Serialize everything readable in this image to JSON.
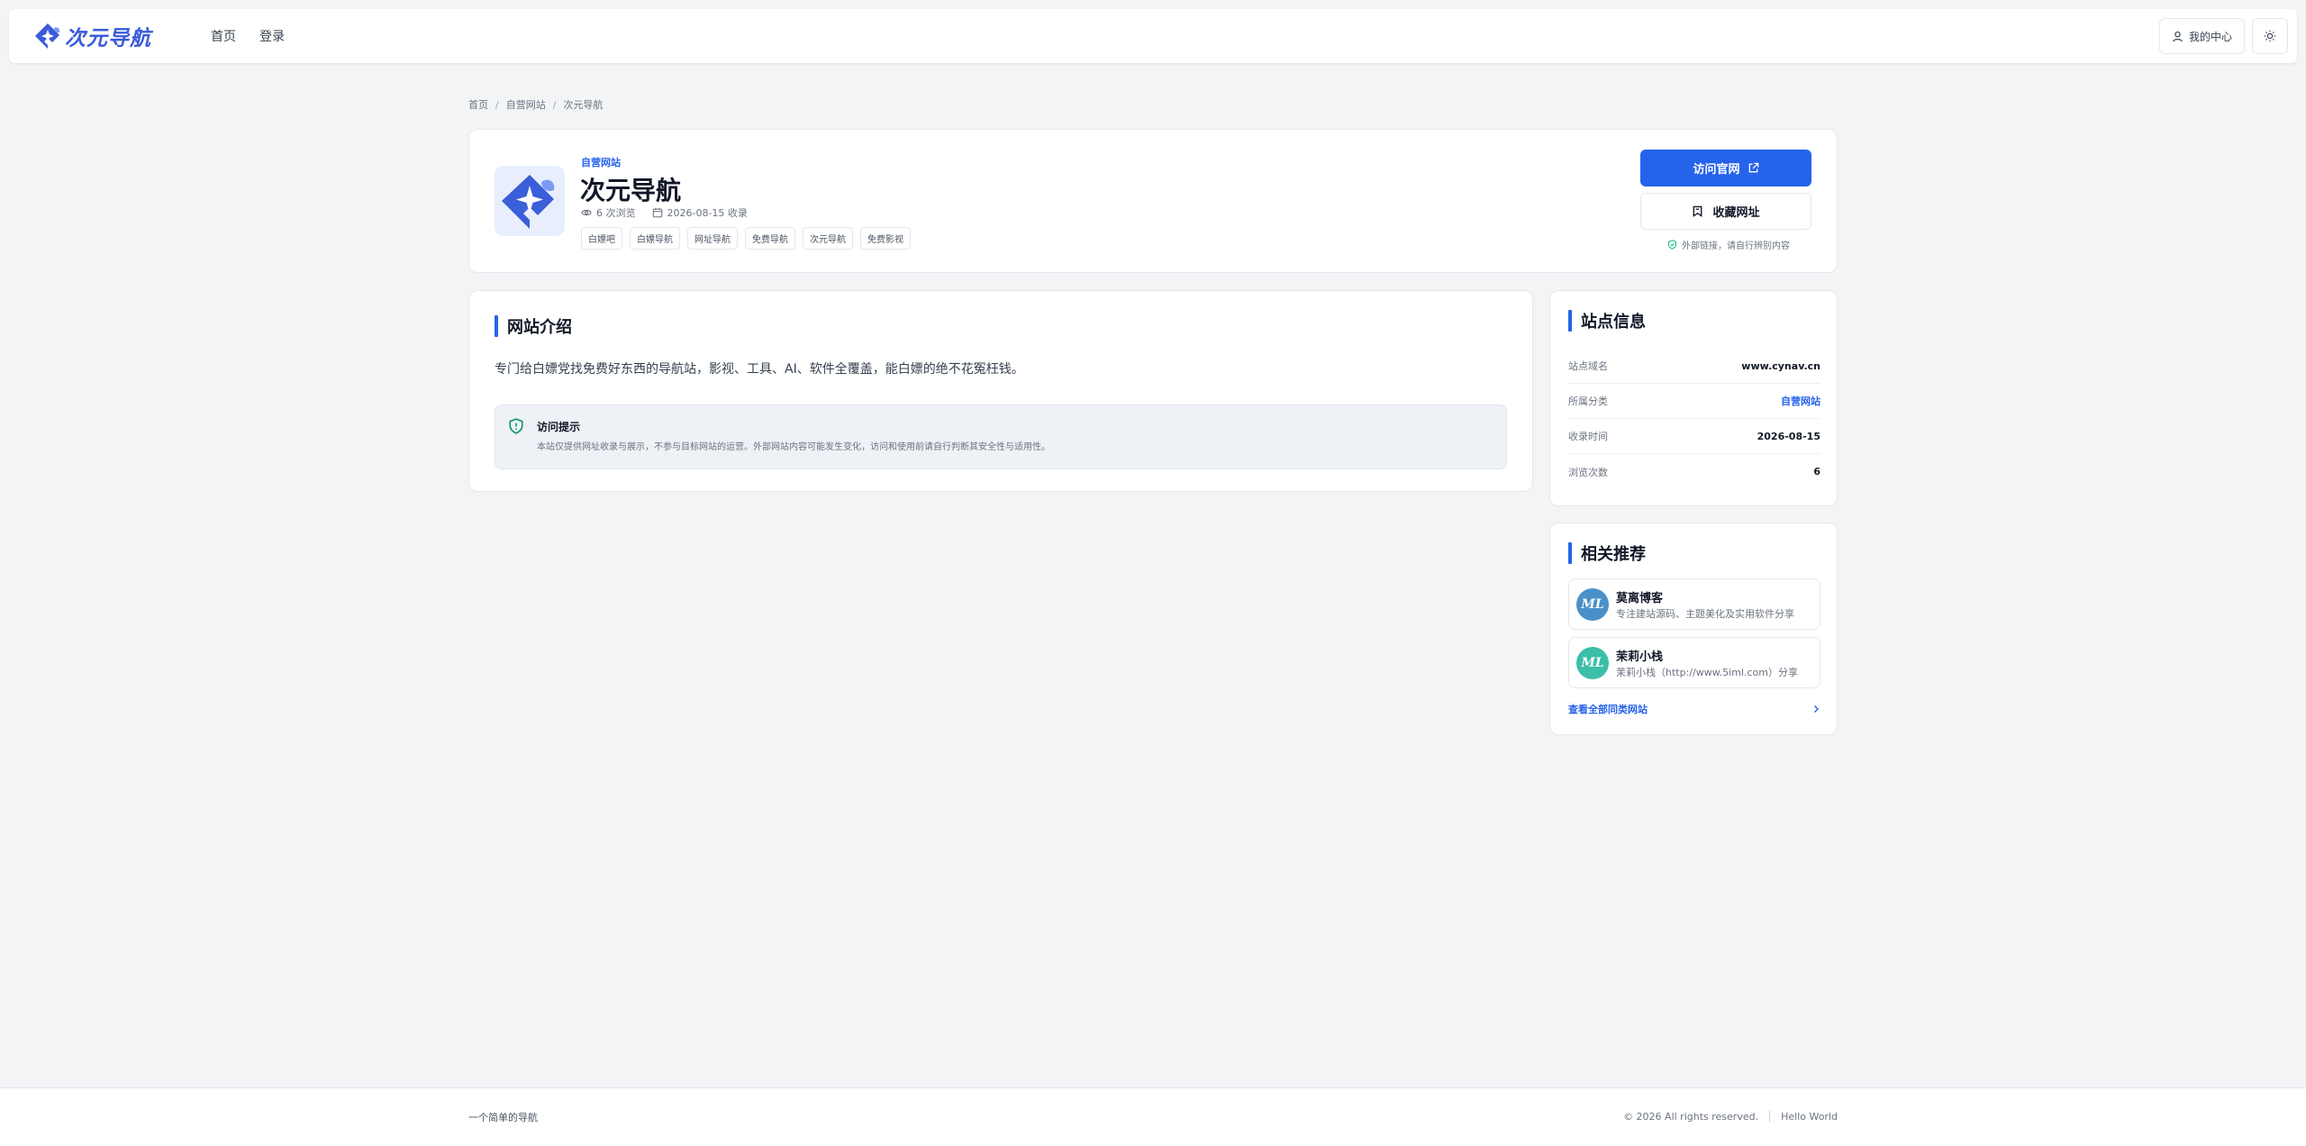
{
  "header": {
    "logo_text": "次元导航",
    "nav": [
      "首页",
      "登录"
    ],
    "user_center": "我的中心"
  },
  "breadcrumb": [
    "首页",
    "自营网站",
    "次元导航"
  ],
  "site": {
    "category": "自营网站",
    "title": "次元导航",
    "views": "6 次浏览",
    "collected": "2026-08-15 收录",
    "tags": [
      "白嫖吧",
      "白嫖导航",
      "网址导航",
      "免费导航",
      "次元导航",
      "免费影视"
    ],
    "visit_label": "访问官网",
    "fav_label": "收藏网址",
    "external_note": "外部链接，请自行辨别内容"
  },
  "intro": {
    "title": "网站介绍",
    "text": "专门给白嫖党找免费好东西的导航站，影视、工具、AI、软件全覆盖，能白嫖的绝不花冤枉钱。",
    "notice_title": "访问提示",
    "notice_text": "本站仅提供网址收录与展示，不参与目标网站的运营。外部网站内容可能发生变化，访问和使用前请自行判断其安全性与适用性。"
  },
  "info": {
    "title": "站点信息",
    "rows": [
      {
        "k": "站点域名",
        "v": "www.cynav.cn"
      },
      {
        "k": "所属分类",
        "v": "自营网站"
      },
      {
        "k": "收录时间",
        "v": "2026-08-15"
      },
      {
        "k": "浏览次数",
        "v": "6"
      }
    ]
  },
  "related": {
    "title": "相关推荐",
    "items": [
      {
        "avatar": "ML",
        "name": "莫离博客",
        "desc": "专注建站源码、主题美化及实用软件分享",
        "color": "#4a90c8"
      },
      {
        "avatar": "ML",
        "name": "茉莉小栈",
        "desc": "茉莉小栈（http://www.5iml.com）分享",
        "color": "#3bbfa8"
      }
    ],
    "more": "查看全部同类网站"
  },
  "footer": {
    "left": "一个简单的导航",
    "copyright": "© 2026 All rights reserved.",
    "right": "Hello World"
  },
  "colors": {
    "accent": "#2563eb",
    "logo": "#3b5bdb"
  }
}
